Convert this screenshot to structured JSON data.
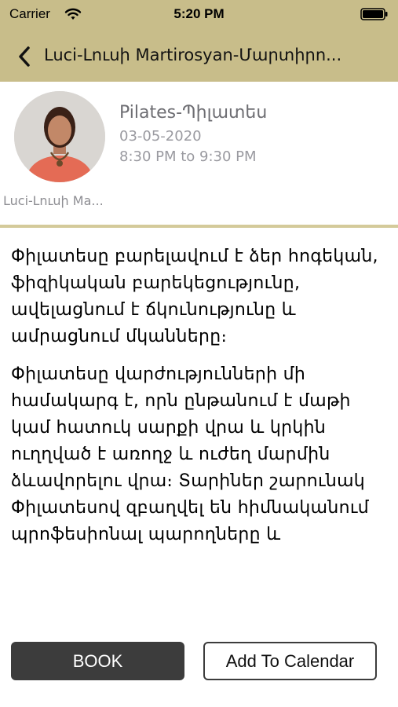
{
  "status_bar": {
    "carrier": "Carrier",
    "time": "5:20 PM",
    "icons": [
      "wifi-icon",
      "battery-icon"
    ]
  },
  "nav": {
    "back_icon": "chevron-left-icon",
    "title": "Luci-Լուսի Martirosyan-Մարտիրո..."
  },
  "class_info": {
    "title": "Pilates-Պիլատես",
    "date": "03-05-2020",
    "time": "8:30 PM to 9:30 PM",
    "trainer_name": "Luci-Լուսի Ma..."
  },
  "description": {
    "paragraphs": [
      "Փիլատեսը բարելավում է ձեր հոգեկան, ֆիզիկական բարեկեցությունը, ավելացնում է ճկունությունը և ամրացնում մկանները։",
      "Փիլատեսը վարժությունների մի համակարգ է, որն ընթանում է մաթի կամ հատուկ սարքի վրա և կրկին ուղղված է առողջ և ուժեղ մարմին ձևավորելու վրա։ Տարիներ շարունակ Փիլատեսով զբաղվել են հիմնականում պրոֆեսիոնալ պարողները և"
    ]
  },
  "actions": {
    "book_label": "BOOK",
    "calendar_label": "Add To Calendar"
  },
  "colors": {
    "header_bg": "#c8bd8a",
    "divider": "#d4ca9a",
    "book_bg": "#3c3c3c"
  }
}
